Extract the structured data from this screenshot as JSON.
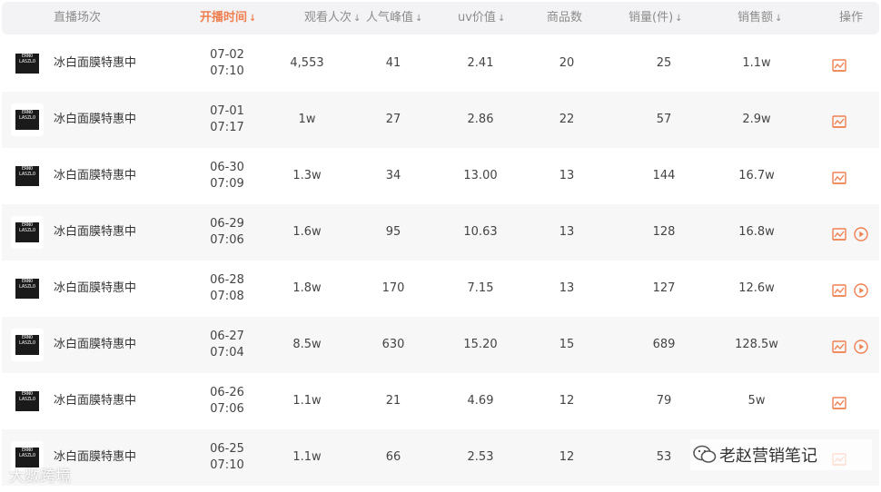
{
  "table": {
    "columns": [
      {
        "label": "直播场次",
        "sortable": false,
        "active": false
      },
      {
        "label": "开播时间",
        "sortable": true,
        "active": true
      },
      {
        "label": "观看人次",
        "sortable": true,
        "active": false
      },
      {
        "label": "人气峰值",
        "sortable": true,
        "active": false
      },
      {
        "label": "uv价值",
        "sortable": true,
        "active": false
      },
      {
        "label": "商品数",
        "sortable": false,
        "active": false
      },
      {
        "label": "销量(件)",
        "sortable": true,
        "active": false
      },
      {
        "label": "销售额",
        "sortable": true,
        "active": false
      },
      {
        "label": "操作",
        "sortable": false,
        "active": false
      }
    ],
    "sort_icon": "sort-down-arrow-icon",
    "rows": [
      {
        "logo_text": [
          "ERNO",
          "LASZLO"
        ],
        "name": "冰白面膜特惠中",
        "date": "07-02",
        "time": "07:10",
        "views": "4,553",
        "peak": "41",
        "uv": "2.41",
        "products": "20",
        "sales_qty": "25",
        "revenue": "1.1w",
        "has_play": false
      },
      {
        "logo_text": [
          "ERNO",
          "LASZLO"
        ],
        "name": "冰白面膜特惠中",
        "date": "07-01",
        "time": "07:17",
        "views": "1w",
        "peak": "27",
        "uv": "2.86",
        "products": "22",
        "sales_qty": "57",
        "revenue": "2.9w",
        "has_play": false
      },
      {
        "logo_text": [
          "ERNO",
          "LASZLO"
        ],
        "name": "冰白面膜特惠中",
        "date": "06-30",
        "time": "07:09",
        "views": "1.3w",
        "peak": "34",
        "uv": "13.00",
        "products": "13",
        "sales_qty": "144",
        "revenue": "16.7w",
        "has_play": false
      },
      {
        "logo_text": [
          "ERNO",
          "LASZLO"
        ],
        "name": "冰白面膜特惠中",
        "date": "06-29",
        "time": "07:06",
        "views": "1.6w",
        "peak": "95",
        "uv": "10.63",
        "products": "13",
        "sales_qty": "128",
        "revenue": "16.8w",
        "has_play": true
      },
      {
        "logo_text": [
          "ERNO",
          "LASZLO"
        ],
        "name": "冰白面膜特惠中",
        "date": "06-28",
        "time": "07:08",
        "views": "1.8w",
        "peak": "170",
        "uv": "7.15",
        "products": "13",
        "sales_qty": "127",
        "revenue": "12.6w",
        "has_play": true
      },
      {
        "logo_text": [
          "ERNO",
          "LASZLO"
        ],
        "name": "冰白面膜特惠中",
        "date": "06-27",
        "time": "07:04",
        "views": "8.5w",
        "peak": "630",
        "uv": "15.20",
        "products": "15",
        "sales_qty": "689",
        "revenue": "128.5w",
        "has_play": true
      },
      {
        "logo_text": [
          "ERNO",
          "LASZLO"
        ],
        "name": "冰白面膜特惠中",
        "date": "06-26",
        "time": "07:06",
        "views": "1.1w",
        "peak": "21",
        "uv": "4.69",
        "products": "12",
        "sales_qty": "79",
        "revenue": "5w",
        "has_play": false
      },
      {
        "logo_text": [
          "ERNO",
          "LASZLO"
        ],
        "name": "冰白面膜特惠中",
        "date": "06-25",
        "time": "07:10",
        "views": "1.1w",
        "peak": "66",
        "uv": "2.53",
        "products": "12",
        "sales_qty": "53",
        "revenue": "",
        "has_play": false
      }
    ]
  },
  "watermarks": {
    "left": "大數跨境",
    "right": "老赵营销笔记"
  },
  "colors": {
    "accent": "#f08050",
    "header_bg": "#f3f3f5",
    "row_alt_bg": "#f7f7f8"
  }
}
